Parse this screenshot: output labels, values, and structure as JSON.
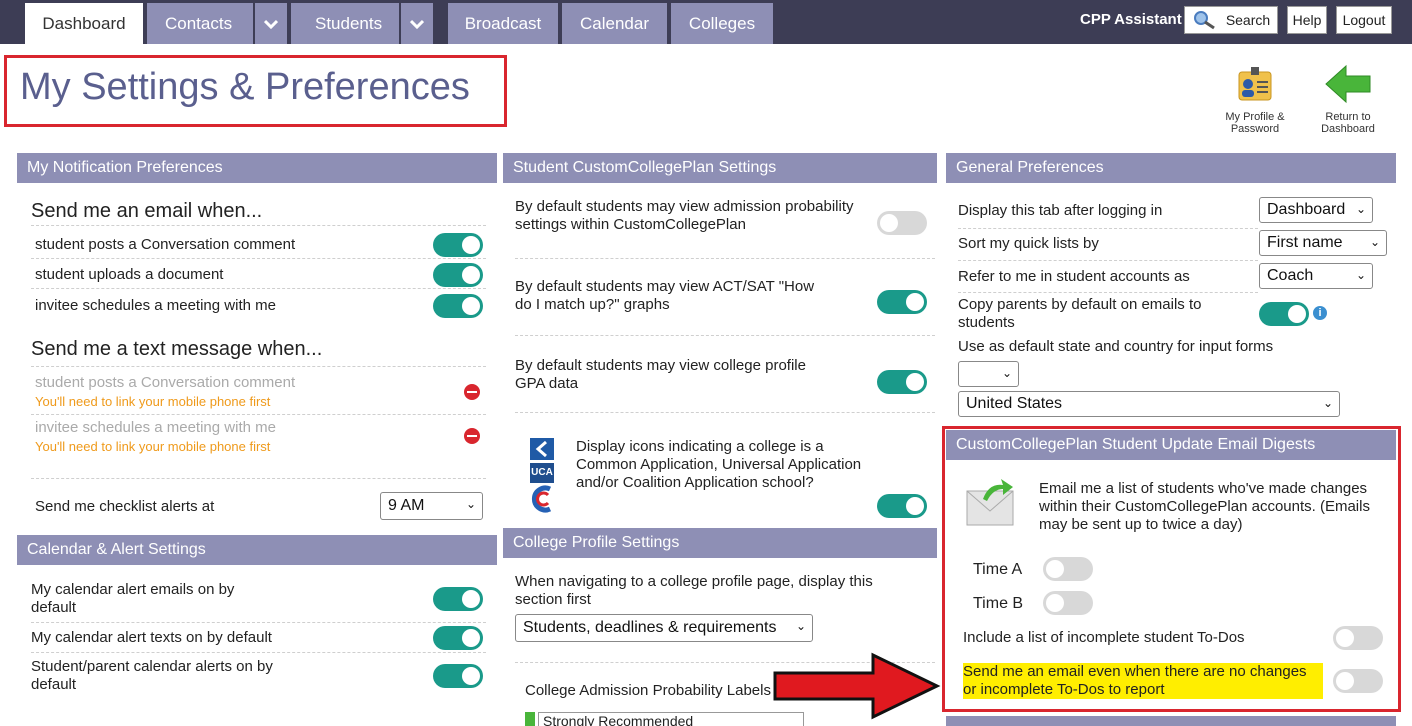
{
  "nav": {
    "tabs": [
      "Dashboard",
      "Contacts",
      "Students",
      "Broadcast",
      "Calendar",
      "Colleges"
    ],
    "assistant": "CPP Assistant",
    "search": "Search",
    "help": "Help",
    "logout": "Logout"
  },
  "page": {
    "title": "My Settings & Preferences",
    "profile_link": "My Profile & Password",
    "return_link": "Return to Dashboard"
  },
  "notifications": {
    "header": "My Notification Preferences",
    "email_heading": "Send me an email when...",
    "email_items": [
      "student posts a Conversation comment",
      "student uploads a document",
      "invitee schedules a meeting with me"
    ],
    "text_heading": "Send me a text message when...",
    "text_items": [
      "student posts a Conversation comment",
      "invitee schedules a meeting with me"
    ],
    "link_phone_warning": "You'll need to link your mobile phone first",
    "checklist_label": "Send me checklist alerts at",
    "checklist_value": "9 AM"
  },
  "calendar": {
    "header": "Calendar & Alert Settings",
    "items": [
      "My calendar alert emails on by default",
      "My calendar alert texts on by default",
      "Student/parent calendar alerts on by default"
    ]
  },
  "student_settings": {
    "header": "Student CustomCollegePlan Settings",
    "items": [
      "By default students may view admission probability settings within CustomCollegePlan",
      "By default students may view ACT/SAT \"How do I match up?\" graphs",
      "By default students may view college profile GPA data",
      "Display icons indicating a college is a Common Application, Universal Application and/or Coalition Application school?"
    ],
    "uca_badge": "UCA"
  },
  "college_profile": {
    "header": "College Profile Settings",
    "label": "When navigating to a college profile page, display this section first",
    "value": "Students, deadlines & requirements",
    "prob_labels": "College Admission Probability Labels",
    "first_label": "Strongly Recommended"
  },
  "general": {
    "header": "General Preferences",
    "tab_label": "Display this tab after logging in",
    "tab_value": "Dashboard",
    "sort_label": "Sort my quick lists by",
    "sort_value": "First name",
    "refer_label": "Refer to me in student accounts as",
    "refer_value": "Coach",
    "copy_label": "Copy parents by default on emails to students",
    "state_label": "Use as default state and country for input forms",
    "state_value": "",
    "country_value": "United States"
  },
  "digest": {
    "header": "CustomCollegePlan Student Update Email Digests",
    "description": "Email me a list of students who've made changes within their CustomCollegePlan accounts. (Emails may be sent up to twice a day)",
    "time_a": "Time A",
    "time_b": "Time B",
    "include_todos": "Include a list of incomplete student To-Dos",
    "send_always": "Send me an email even when there are no changes or incomplete To-Dos to report"
  },
  "colors": {
    "accent": "#8e8fb5",
    "nav": "#3d3d55",
    "toggle_on": "#1a9a8a",
    "highlight": "#d9262e"
  }
}
